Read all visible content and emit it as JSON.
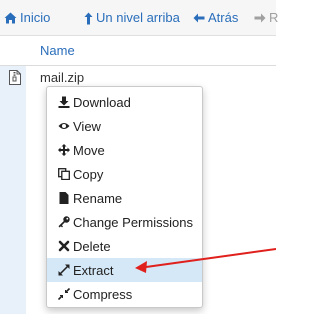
{
  "toolbar": {
    "home_label": "Inicio",
    "up_label": "Un nivel arriba",
    "back_label": "Atrás",
    "forward_label": "R",
    "link_color": "#2a6ebb",
    "disabled_color": "#a0a0a0"
  },
  "table": {
    "name_header": "Name",
    "rows": [
      {
        "name": "mail.zip",
        "icon": "zip-file-icon"
      }
    ]
  },
  "context_menu": {
    "items": [
      {
        "label": "Download",
        "icon": "download-icon"
      },
      {
        "label": "View",
        "icon": "eye-icon"
      },
      {
        "label": "Move",
        "icon": "move-icon"
      },
      {
        "label": "Copy",
        "icon": "copy-icon"
      },
      {
        "label": "Rename",
        "icon": "file-icon"
      },
      {
        "label": "Change Permissions",
        "icon": "key-icon"
      },
      {
        "label": "Delete",
        "icon": "close-icon"
      },
      {
        "label": "Extract",
        "icon": "expand-icon",
        "highlighted": true
      },
      {
        "label": "Compress",
        "icon": "compress-icon"
      }
    ],
    "highlight_color": "#d5e8f7"
  },
  "annotation": {
    "arrow_color": "#e0201c",
    "points_to": "Extract"
  }
}
